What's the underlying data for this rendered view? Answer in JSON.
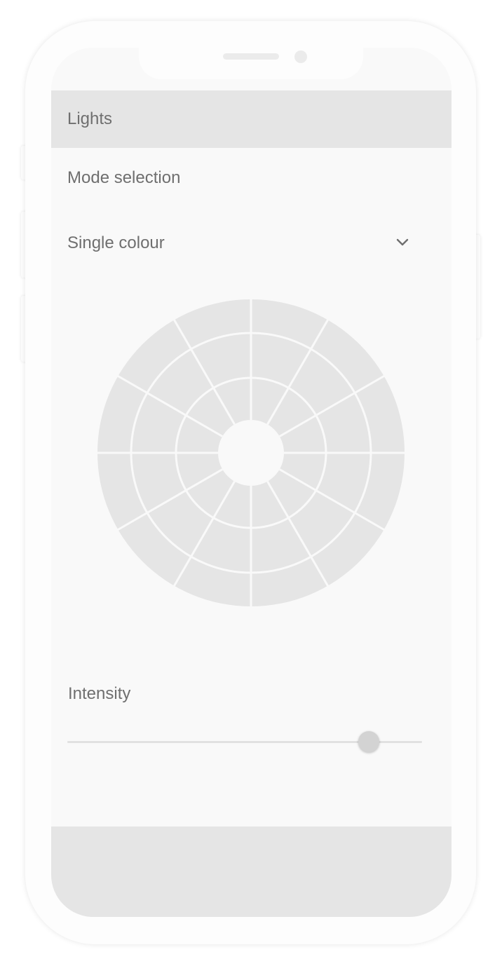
{
  "header": {
    "title": "Lights"
  },
  "mode": {
    "label": "Mode selection",
    "selected": "Single colour",
    "chevron_icon": "chevron-down-icon"
  },
  "color_wheel": {
    "segments": 12,
    "rings": 3,
    "fill_color": "#e5e5e5",
    "divider_color": "#f9f9f9"
  },
  "intensity": {
    "label": "Intensity",
    "value_fraction": 0.85
  },
  "colors": {
    "screen_bg": "#f9f9f9",
    "panel": "#e5e5e5",
    "text": "#6f6f6f"
  }
}
